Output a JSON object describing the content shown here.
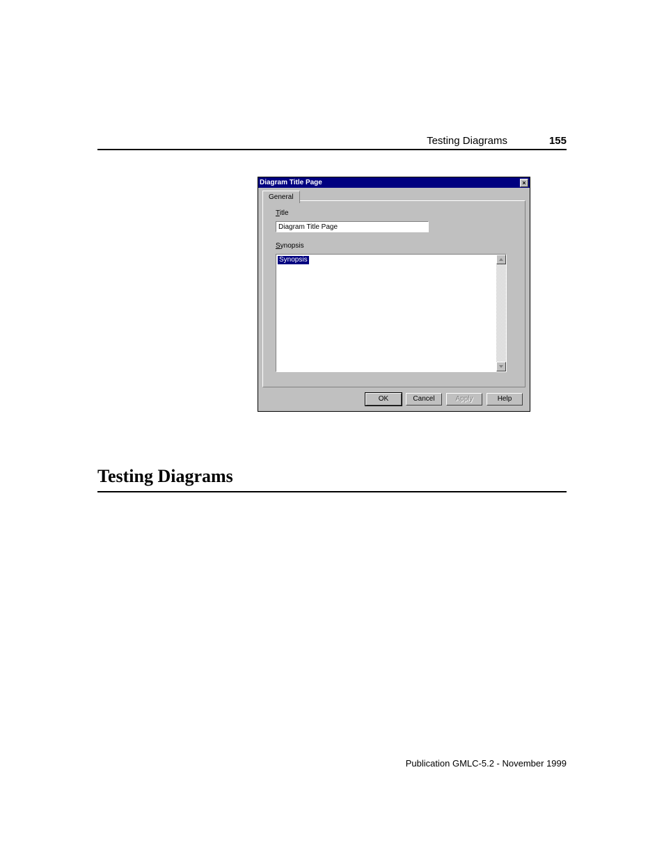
{
  "header": {
    "running_title": "Testing Diagrams",
    "page_number": "155"
  },
  "dialog": {
    "titlebar": "Diagram Title Page",
    "close": "×",
    "tab": "General",
    "title_label_prefix": "T",
    "title_label_rest": "itle",
    "title_value": "Diagram Title Page",
    "synopsis_label_prefix": "S",
    "synopsis_label_rest": "ynopsis",
    "synopsis_value": "Synopsis",
    "buttons": {
      "ok": "OK",
      "cancel": "Cancel",
      "apply": "Apply",
      "help": "Help"
    }
  },
  "section": {
    "heading": "Testing Diagrams"
  },
  "footer": {
    "text": "Publication GMLC-5.2 - November 1999"
  }
}
